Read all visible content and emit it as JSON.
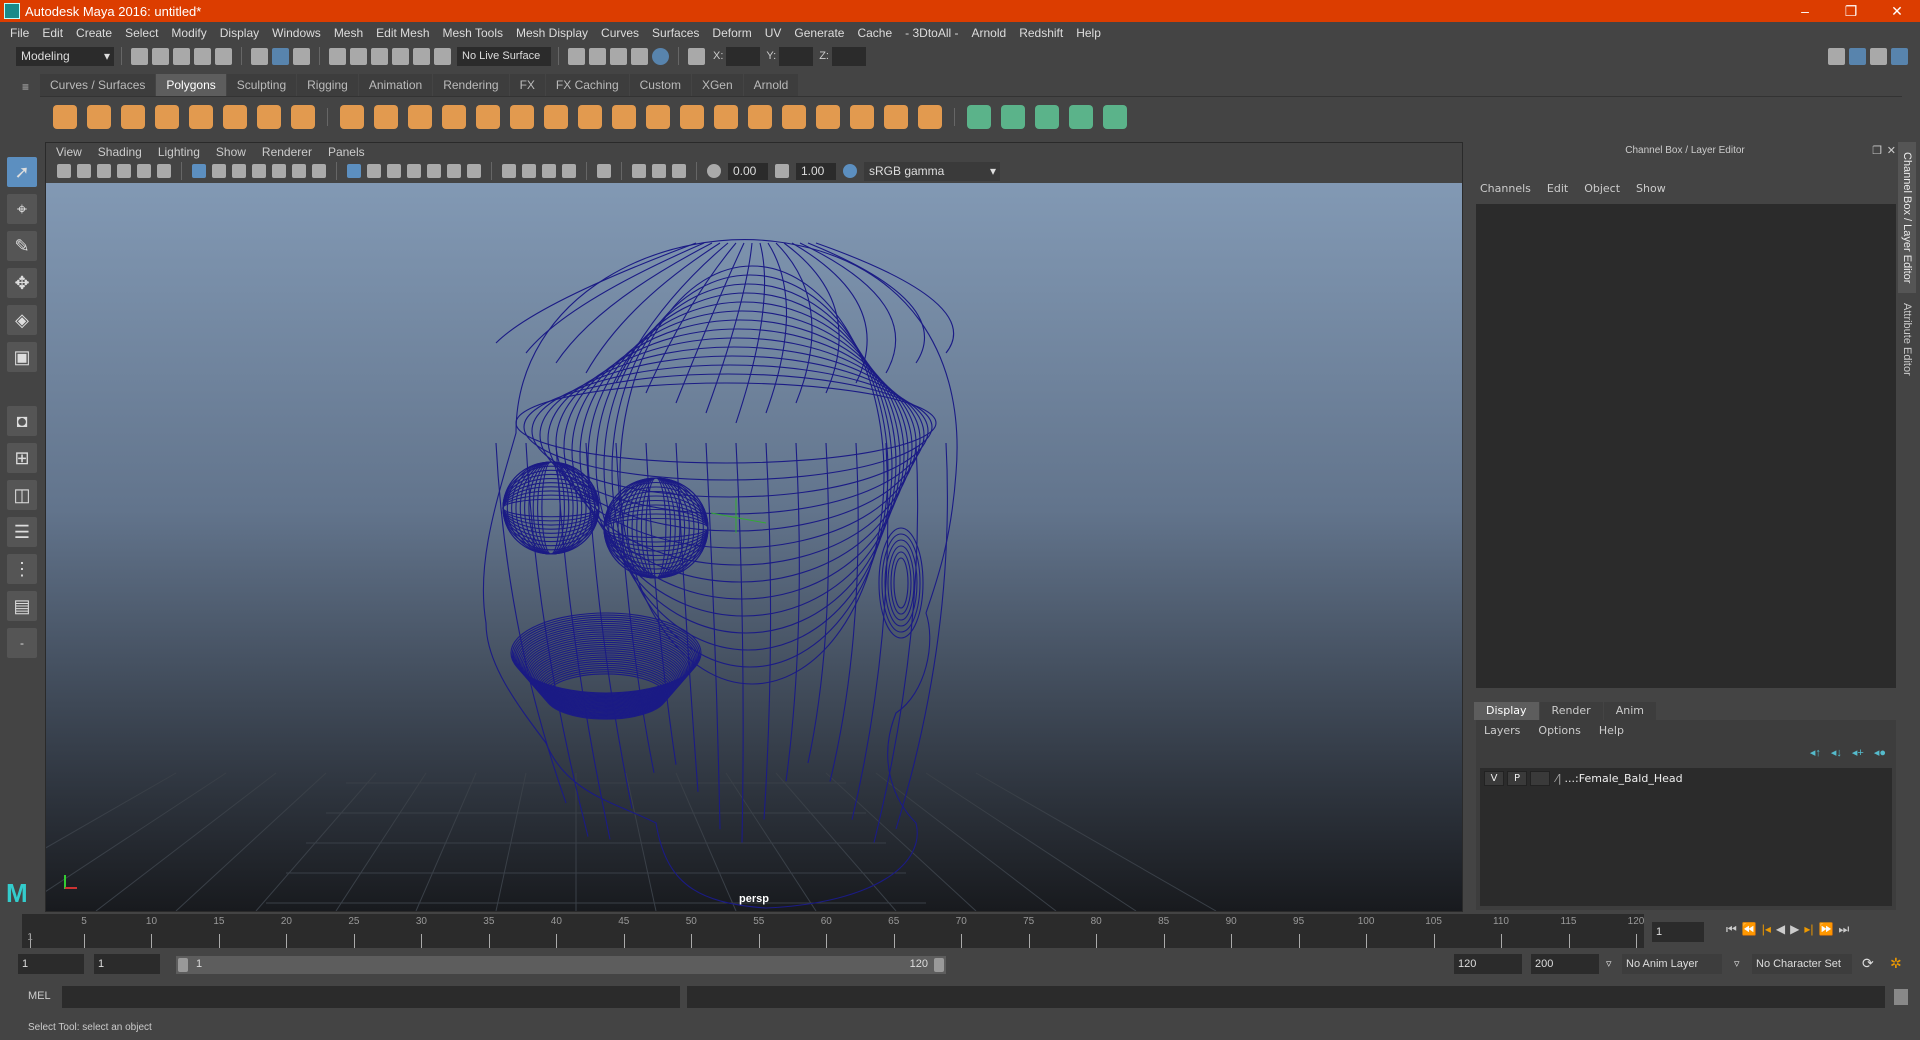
{
  "title": "Autodesk Maya 2016: untitled*",
  "menus": [
    "File",
    "Edit",
    "Create",
    "Select",
    "Modify",
    "Display",
    "Windows",
    "Mesh",
    "Edit Mesh",
    "Mesh Tools",
    "Mesh Display",
    "Curves",
    "Surfaces",
    "Deform",
    "UV",
    "Generate",
    "Cache",
    "- 3DtoAll -",
    "Arnold",
    "Redshift",
    "Help"
  ],
  "statusline": {
    "mode": "Modeling",
    "live_surface": "No Live Surface",
    "x_label": "X:",
    "y_label": "Y:",
    "z_label": "Z:"
  },
  "shelf_tabs": [
    "Curves / Surfaces",
    "Polygons",
    "Sculpting",
    "Rigging",
    "Animation",
    "Rendering",
    "FX",
    "FX Caching",
    "Custom",
    "XGen",
    "Arnold"
  ],
  "shelf_active": "Polygons",
  "panel_menus": [
    "View",
    "Shading",
    "Lighting",
    "Show",
    "Renderer",
    "Panels"
  ],
  "panel_tools": {
    "exposure": "0.00",
    "gamma": "1.00",
    "color_space": "sRGB gamma"
  },
  "viewport": {
    "camera": "persp",
    "wire_color": "#1b1b85"
  },
  "channel_box": {
    "title": "Channel Box / Layer Editor",
    "menus": [
      "Channels",
      "Edit",
      "Object",
      "Show"
    ],
    "layer_tabs": [
      "Display",
      "Render",
      "Anim"
    ],
    "layer_menus": [
      "Layers",
      "Options",
      "Help"
    ],
    "layer": {
      "v": "V",
      "p": "P",
      "name": "...:Female_Bald_Head"
    }
  },
  "side_tabs": [
    "Channel Box / Layer Editor",
    "Attribute Editor"
  ],
  "timeline": {
    "start": 1,
    "end": 120,
    "label_step": 5,
    "current_frame": "1"
  },
  "range": {
    "start": "1",
    "playback_start": "1",
    "slider_start": "1",
    "slider_end": "120",
    "playback_end": "120",
    "end": "200",
    "anim_layer": "No Anim Layer",
    "character_set": "No Character Set"
  },
  "mel": {
    "label": "MEL"
  },
  "help_line": "Select Tool: select an object"
}
